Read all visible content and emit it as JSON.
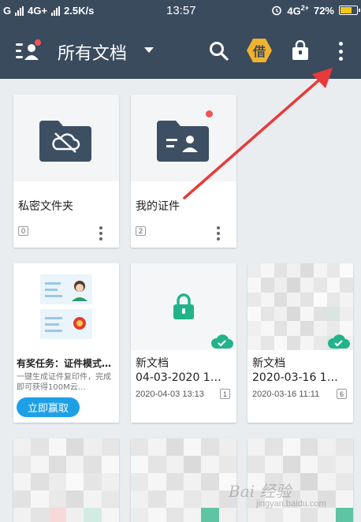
{
  "status_bar": {
    "carrier_left": "G",
    "network": "4G+",
    "speed": "2.5K/s",
    "time": "13:57",
    "network_right": "4G",
    "network_right_sup": "2+",
    "battery": "72%",
    "battery_level": 0.72
  },
  "toolbar": {
    "title": "所有文档",
    "borrow_label": "借",
    "icons": [
      "user-badge-icon",
      "search-icon",
      "borrow-icon",
      "lock-bag-icon",
      "more-vertical-icon"
    ]
  },
  "folders": [
    {
      "name": "私密文件夹",
      "count": "0",
      "icon": "cloud-off-folder-icon"
    },
    {
      "name": "我的证件",
      "count": "2",
      "icon": "id-card-folder-icon"
    }
  ],
  "promo": {
    "title": "有奖任务：证件模式…",
    "desc": "一键生成证件复印件，完成即可获得100M云…",
    "button": "立即赢取"
  },
  "documents": [
    {
      "title_line1": "新文档",
      "title_line2": "04-03-2020 1…",
      "date": "2020-04-03 13:13",
      "count": "1"
    },
    {
      "title_line1": "新文档",
      "title_line2": "2020-03-16 1…",
      "date": "2020-03-16 11:11",
      "count": "6"
    }
  ],
  "watermark": {
    "text": "Bai 经验",
    "sub": "jingyan.baidu.com"
  },
  "colors": {
    "toolbar": "#3b4b5e",
    "accent_green": "#22b38a",
    "promo_button": "#1ea0e6",
    "badge_red": "#f05454",
    "borrow_hex": "#f0b130",
    "arrow_red": "#e83a3a"
  }
}
